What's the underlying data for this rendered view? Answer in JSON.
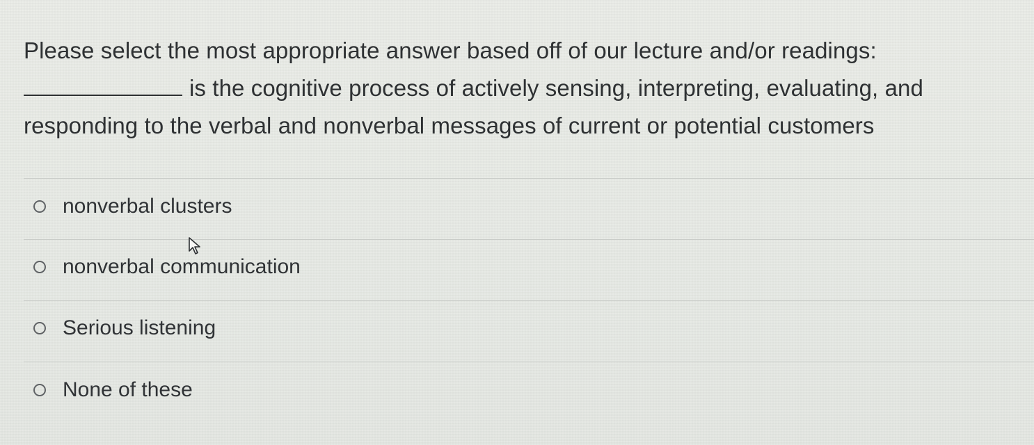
{
  "question": {
    "line1": "Please select the most appropriate answer based off of our lecture and/or readings:",
    "line2": "is the cognitive process of actively sensing, interpreting, evaluating, and",
    "line3": "responding to the verbal and nonverbal messages of current or potential customers"
  },
  "options": [
    {
      "label": "nonverbal clusters"
    },
    {
      "label": "nonverbal communication"
    },
    {
      "label": "Serious listening"
    },
    {
      "label": "None of these"
    }
  ],
  "icons": {
    "radio": "radio-unselected-icon",
    "cursor": "mouse-pointer-icon"
  },
  "colors": {
    "background": "#e6e9e4",
    "text": "#2e3133",
    "divider": "#c9ccc8"
  }
}
